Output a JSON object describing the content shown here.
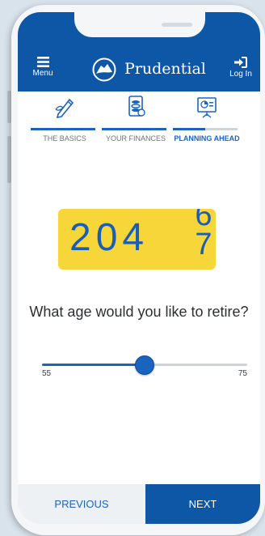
{
  "header": {
    "menu_label": "Menu",
    "brand": "Prudential",
    "login_label": "Log In"
  },
  "steps": [
    {
      "label": "THE BASICS",
      "icon": "pencil-icon",
      "progress": 1.0
    },
    {
      "label": "YOUR FINANCES",
      "icon": "coins-icon",
      "progress": 1.0
    },
    {
      "label": "PLANNING AHEAD",
      "icon": "presentation-icon",
      "progress": 0.5,
      "active": true
    }
  ],
  "odometer": {
    "digits": "204",
    "roll_top": "6",
    "roll_bottom": "7"
  },
  "question": "What age would you like to retire?",
  "slider": {
    "min_label": "55",
    "max_label": "75",
    "position": 0.5
  },
  "footer": {
    "previous_label": "PREVIOUS",
    "next_label": "NEXT"
  },
  "colors": {
    "primary": "#0e56a6",
    "accent": "#1a64c0",
    "odometer_bg": "#f7d63a"
  }
}
